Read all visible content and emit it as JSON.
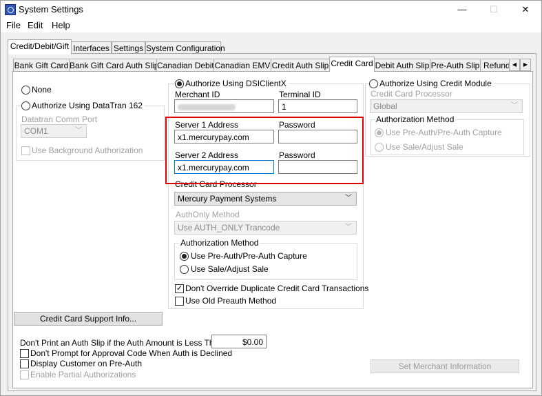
{
  "window": {
    "title": "System Settings",
    "minimize_label": "—",
    "maximize_label": "☐",
    "close_label": "✕"
  },
  "menu": [
    "File",
    "Edit",
    "Help"
  ],
  "outer_tabs": [
    "Credit/Debit/Gift",
    "Interfaces",
    "Settings",
    "System Configuration"
  ],
  "inner_tabs": [
    "Bank Gift Card",
    "Bank Gift Card Auth Slip",
    "Canadian Debit",
    "Canadian EMV",
    "Credit Auth Slip",
    "Credit Card",
    "Debit Auth Slip",
    "Pre-Auth Slip",
    "Refund"
  ],
  "left": {
    "none_label": "None",
    "datatran_label": "Authorize Using DataTran 162",
    "comm_port_label": "Datatran Comm Port",
    "comm_port_value": "COM1",
    "background_auth_label": "Use Background Authorization",
    "support_button": "Credit Card Support Info..."
  },
  "middle": {
    "dsi_label": "Authorize Using DSIClientX",
    "merchant_id_label": "Merchant ID",
    "terminal_id_label": "Terminal ID",
    "terminal_id_value": "1",
    "server1_label": "Server 1 Address",
    "server1_value": "x1.mercurypay.com",
    "password1_label": "Password",
    "server2_label": "Server 2 Address",
    "server2_value": "x1.mercurypay.com",
    "password2_label": "Password",
    "processor_label": "Credit Card Processor",
    "processor_value": "Mercury Payment Systems",
    "authonly_label": "AuthOnly Method",
    "authonly_value": "Use AUTH_ONLY Trancode",
    "auth_method_label": "Authorization Method",
    "preauth_label": "Use Pre-Auth/Pre-Auth Capture",
    "sale_label": "Use Sale/Adjust Sale",
    "dont_override_label": "Don't Override Duplicate Credit Card Transactions",
    "old_preauth_label": "Use Old Preauth Method"
  },
  "right": {
    "credit_module_label": "Authorize Using Credit Module",
    "processor_label": "Credit Card Processor",
    "processor_value": "Global",
    "auth_method_label": "Authorization Method",
    "preauth_label": "Use Pre-Auth/Pre-Auth Capture",
    "sale_label": "Use Sale/Adjust Sale",
    "merchant_button": "Set Merchant Information"
  },
  "bottom": {
    "auth_slip_label": "Don't Print an Auth Slip if the Auth Amount is Less Than",
    "auth_slip_value": "$0.00",
    "dont_prompt_label": "Don't Prompt for Approval Code When Auth is Declined",
    "display_customer_label": "Display Customer on Pre-Auth",
    "partial_auth_label": "Enable Partial Authorizations"
  }
}
